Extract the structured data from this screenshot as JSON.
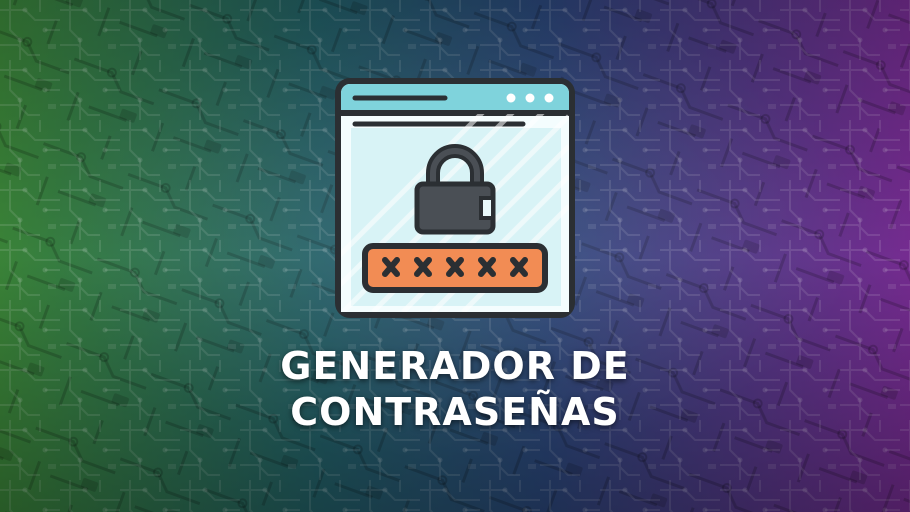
{
  "title": {
    "line1": "GENERADOR DE",
    "line2": "CONTRASEÑAS"
  },
  "icon": {
    "name": "password-window-icon",
    "masked_password": "*****"
  },
  "colors": {
    "background_left": "#3f8a3a",
    "background_middle": "#1f5a6a",
    "background_right": "#7a2f9a",
    "window_frame": "#2b2f33",
    "window_header": "#7fd3dc",
    "window_body": "#e9f9fb",
    "lock_body": "#4a4f55",
    "password_field": "#f28c54",
    "title_text": "#ffffff"
  }
}
